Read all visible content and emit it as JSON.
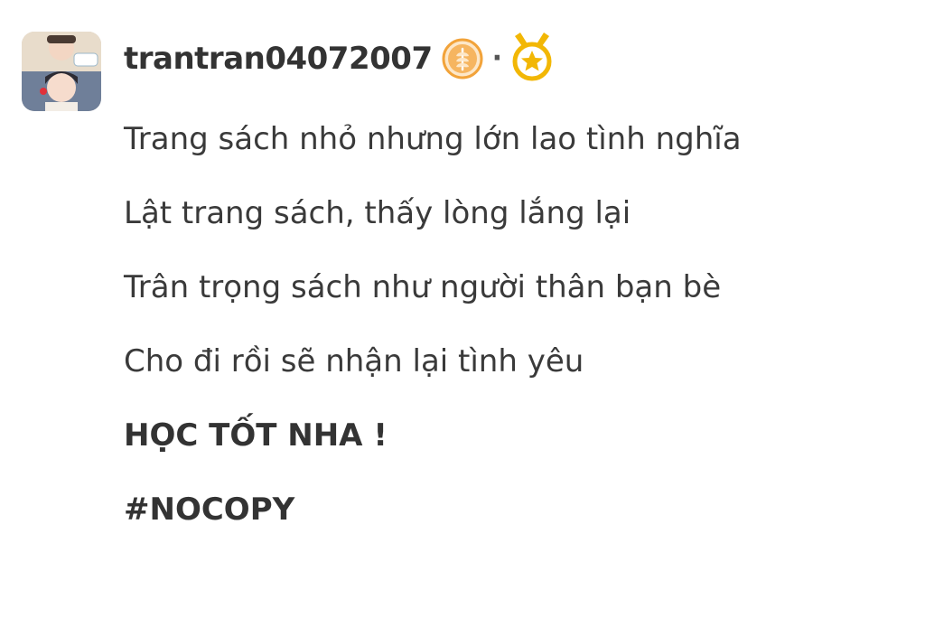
{
  "post": {
    "author": {
      "username": "trantran04072007",
      "avatar_icon": "avatar-photo",
      "rank_badge_icon": "wheat-badge-icon",
      "medal_icon": "star-medal-icon",
      "separator": "·"
    },
    "lines": [
      "Trang sách nhỏ nhưng lớn lao tình nghĩa",
      "Lật trang sách, thấy lòng lắng lại",
      "Trân trọng sách như người thân bạn bè",
      "Cho đi rồi sẽ nhận lại tình yêu",
      "HỌC TỐT NHA !",
      "#NOCOPY"
    ]
  },
  "colors": {
    "text": "#333333",
    "badge_orange": "#f2a33a",
    "medal_gold": "#f2b705"
  }
}
